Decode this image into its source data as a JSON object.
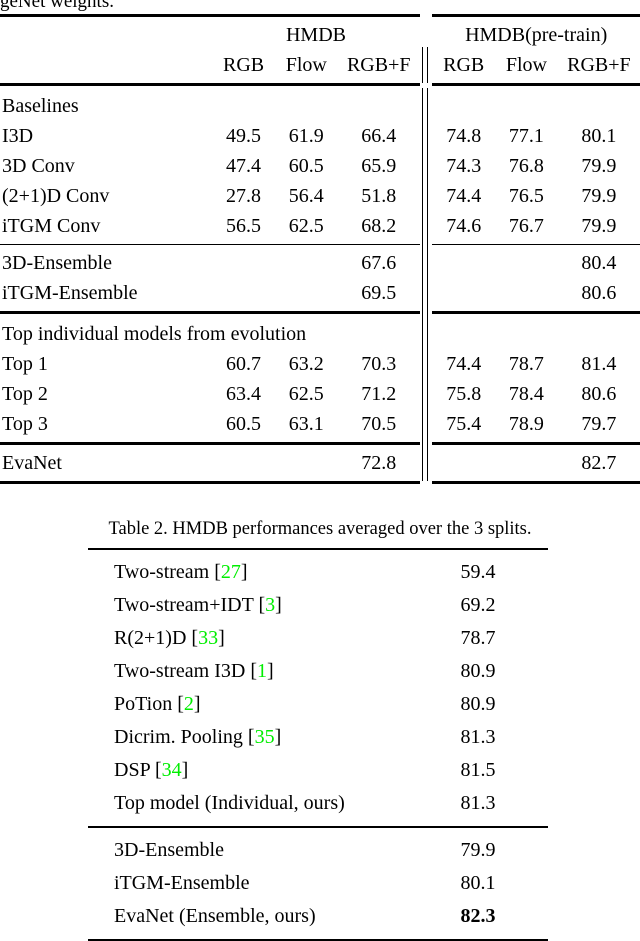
{
  "page": {
    "clipped_top_line": "geNet weights.",
    "citation_color": "#00ee00"
  },
  "table2": {
    "caption": "Table 2. HMDB performances averaged over the 3 splits.",
    "group_headers": [
      "HMDB",
      "HMDB(pre-train)"
    ],
    "column_headers": [
      "RGB",
      "Flow",
      "RGB+F",
      "RGB",
      "Flow",
      "RGB+F"
    ],
    "sections": [
      {
        "heading": "Baselines",
        "rows": [
          {
            "label": "I3D",
            "values": [
              "49.5",
              "61.9",
              "66.4",
              "74.8",
              "77.1",
              "80.1"
            ]
          },
          {
            "label": "3D Conv",
            "values": [
              "47.4",
              "60.5",
              "65.9",
              "74.3",
              "76.8",
              "79.9"
            ]
          },
          {
            "label": "(2+1)D Conv",
            "values": [
              "27.8",
              "56.4",
              "51.8",
              "74.4",
              "76.5",
              "79.9"
            ]
          },
          {
            "label": "iTGM Conv",
            "values": [
              "56.5",
              "62.5",
              "68.2",
              "74.6",
              "76.7",
              "79.9"
            ]
          }
        ]
      },
      {
        "heading": "",
        "rows": [
          {
            "label": "3D-Ensemble",
            "values": [
              "",
              "",
              "67.6",
              "",
              "",
              "80.4"
            ]
          },
          {
            "label": "iTGM-Ensemble",
            "values": [
              "",
              "",
              "69.5",
              "",
              "",
              "80.6"
            ]
          }
        ]
      },
      {
        "heading": "Top individual models from evolution",
        "rows": [
          {
            "label": "Top 1",
            "values": [
              "60.7",
              "63.2",
              "70.3",
              "74.4",
              "78.7",
              "81.4"
            ],
            "bold": [
              false,
              false,
              false,
              false,
              false,
              true
            ]
          },
          {
            "label": "Top 2",
            "values": [
              "63.4",
              "62.5",
              "71.2",
              "75.8",
              "78.4",
              "80.6"
            ],
            "bold": [
              false,
              false,
              true,
              false,
              false,
              false
            ]
          },
          {
            "label": "Top 3",
            "values": [
              "60.5",
              "63.1",
              "70.5",
              "75.4",
              "78.9",
              "79.7"
            ],
            "bold": [
              false,
              false,
              false,
              false,
              false,
              false
            ]
          }
        ]
      },
      {
        "heading": "",
        "rows": [
          {
            "label": "EvaNet",
            "values": [
              "",
              "",
              "72.8",
              "",
              "",
              "82.7"
            ],
            "bold": [
              false,
              false,
              true,
              false,
              false,
              true
            ]
          }
        ]
      }
    ]
  },
  "table3": {
    "sections": [
      {
        "rows": [
          {
            "label": "Two-stream",
            "citation": "27",
            "value": "59.4",
            "bold": false
          },
          {
            "label": "Two-stream+IDT",
            "citation": "3",
            "value": "69.2",
            "bold": false
          },
          {
            "label": "R(2+1)D",
            "citation": "33",
            "value": "78.7",
            "bold": false
          },
          {
            "label": "Two-stream I3D",
            "citation": "1",
            "value": "80.9",
            "bold": false
          },
          {
            "label": "PoTion",
            "citation": "2",
            "value": "80.9",
            "bold": false
          },
          {
            "label": "Dicrim. Pooling",
            "citation": "35",
            "value": "81.3",
            "bold": false
          },
          {
            "label": "DSP",
            "citation": "34",
            "value": "81.5",
            "bold": false
          },
          {
            "label": "Top model (Individual, ours)",
            "citation": "",
            "value": "81.3",
            "bold": false
          }
        ]
      },
      {
        "rows": [
          {
            "label": "3D-Ensemble",
            "citation": "",
            "value": "79.9",
            "bold": false
          },
          {
            "label": "iTGM-Ensemble",
            "citation": "",
            "value": "80.1",
            "bold": false
          },
          {
            "label": "EvaNet (Ensemble, ours)",
            "citation": "",
            "value": "82.3",
            "bold": true
          }
        ]
      }
    ]
  }
}
